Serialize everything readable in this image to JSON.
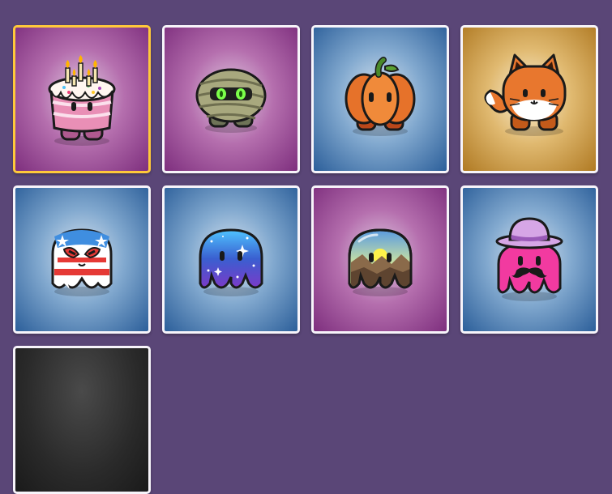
{
  "grid": {
    "selected_index": 0,
    "tiles": [
      {
        "icon": "birthday-cake-blook-icon",
        "background": "purple"
      },
      {
        "icon": "mummy-blook-icon",
        "background": "purple"
      },
      {
        "icon": "pumpkin-blook-icon",
        "background": "blue"
      },
      {
        "icon": "fox-blook-icon",
        "background": "gold"
      },
      {
        "icon": "luchador-blook-icon",
        "background": "blue"
      },
      {
        "icon": "galaxy-blook-icon",
        "background": "blue"
      },
      {
        "icon": "landscape-blook-icon",
        "background": "purple"
      },
      {
        "icon": "mustache-pink-blook-icon",
        "background": "blue"
      },
      {
        "icon": "locked-blook-icon",
        "background": "dark"
      }
    ]
  },
  "colors": {
    "page_background": "#5a4677",
    "selected_border": "#ffc93a",
    "tile_border": "#f7f4fa",
    "purple_background": "#7e2f7e",
    "blue_background": "#2c5f9a",
    "gold_background": "#b07a23"
  }
}
